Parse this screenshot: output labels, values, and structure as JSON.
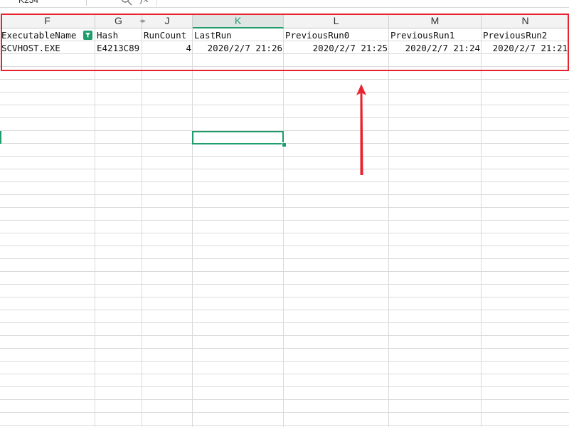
{
  "toolbar": {
    "name_box": "K234",
    "search_icon": "search-icon",
    "fx_label": "fx"
  },
  "columns": [
    {
      "letter": "F"
    },
    {
      "letter": "G"
    },
    {
      "letter": "J"
    },
    {
      "letter": "K",
      "active": true
    },
    {
      "letter": "L"
    },
    {
      "letter": "M"
    },
    {
      "letter": "N"
    }
  ],
  "table": {
    "headers": [
      "ExecutableName",
      "Hash",
      "RunCount",
      "LastRun",
      "PreviousRun0",
      "PreviousRun1",
      "PreviousRun2"
    ],
    "rows": [
      [
        "SCVHOST.EXE",
        "E4213C89",
        "4",
        "2020/2/7 21:26",
        "2020/2/7 21:25",
        "2020/2/7 21:24",
        "2020/2/7 21:21"
      ]
    ]
  },
  "colors": {
    "accent": "#1e9c6b",
    "annotation": "#e8232f"
  }
}
